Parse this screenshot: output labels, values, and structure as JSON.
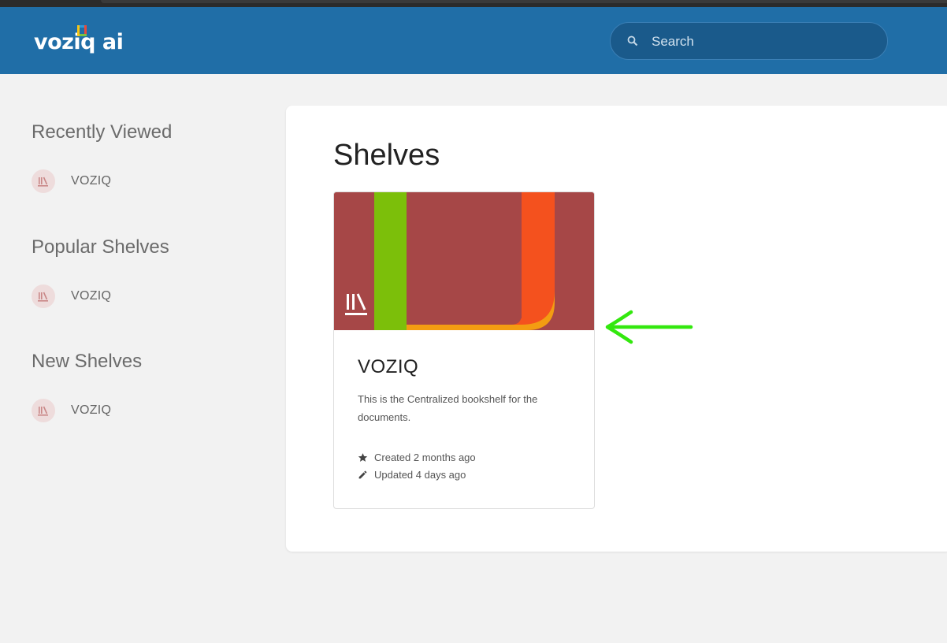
{
  "header": {
    "logo": "voziq ai",
    "search": {
      "placeholder": "Search",
      "value": ""
    }
  },
  "sidebar": {
    "sections": [
      {
        "title": "Recently Viewed",
        "items": [
          {
            "label": "VOZIQ",
            "icon": "shelf-icon"
          }
        ]
      },
      {
        "title": "Popular Shelves",
        "items": [
          {
            "label": "VOZIQ",
            "icon": "shelf-icon"
          }
        ]
      },
      {
        "title": "New Shelves",
        "items": [
          {
            "label": "VOZIQ",
            "icon": "shelf-icon"
          }
        ]
      }
    ]
  },
  "main": {
    "title": "Shelves",
    "cards": [
      {
        "name": "VOZIQ",
        "description": "This is the Centralized bookshelf for the documents.",
        "created": "Created 2 months ago",
        "updated": "Updated 4 days ago"
      }
    ]
  },
  "colors": {
    "header": "#206ea7",
    "cover": "#a64747",
    "annotation_arrow": "#33e80e"
  }
}
